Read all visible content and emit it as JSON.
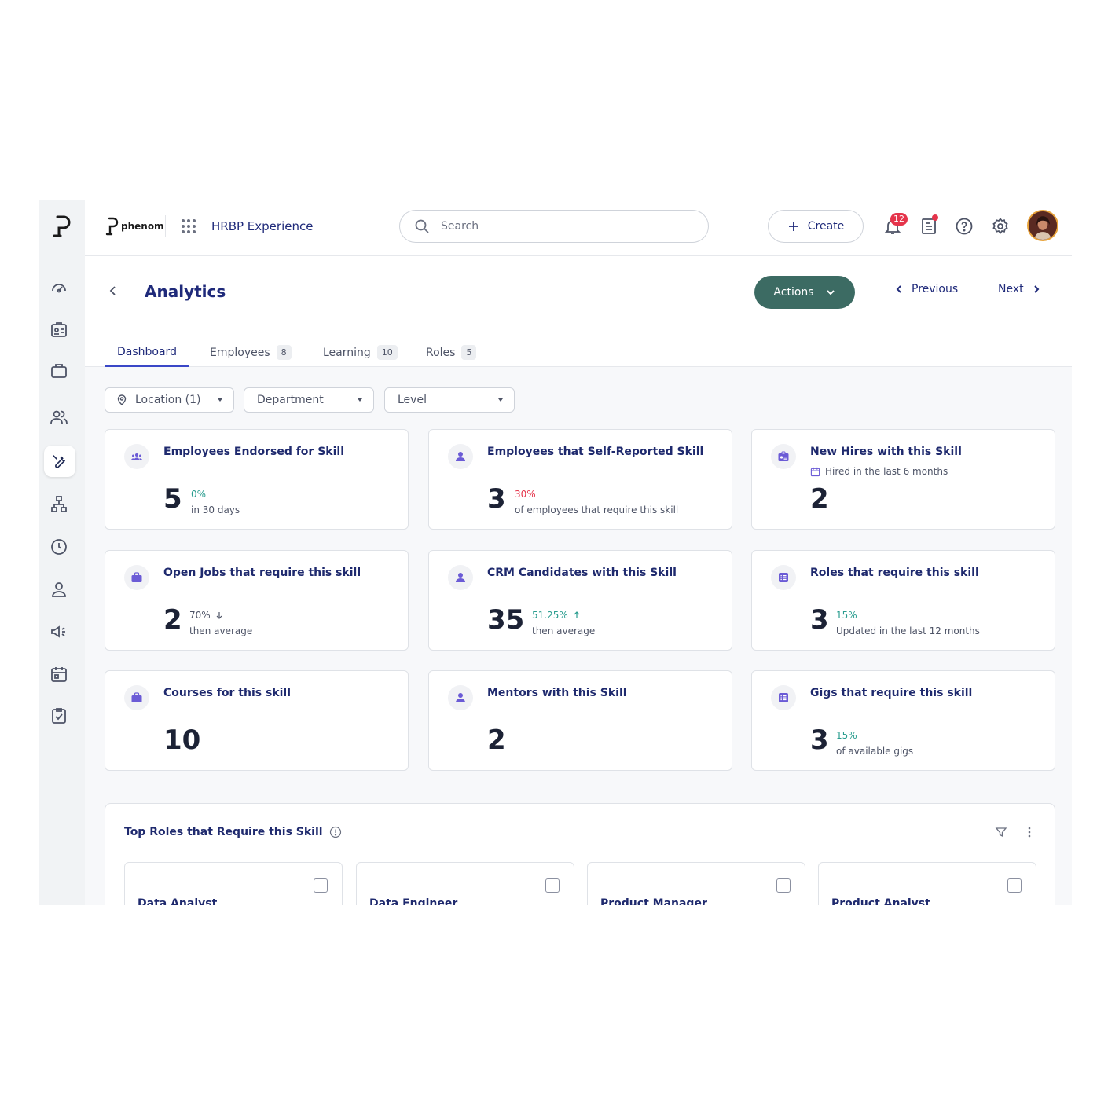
{
  "topbar": {
    "brand_name": "phenom",
    "app_title": "HRBP Experience",
    "search_placeholder": "Search",
    "create_label": "Create",
    "notifications_count": "12"
  },
  "rail": {
    "items": [
      "dashboard",
      "contacts",
      "briefcase",
      "people",
      "skills",
      "org-chart",
      "history",
      "person",
      "campaigns",
      "calendar",
      "tasks"
    ]
  },
  "page": {
    "title": "Analytics",
    "actions_label": "Actions",
    "previous_label": "Previous",
    "next_label": "Next"
  },
  "tabs": [
    {
      "label": "Dashboard",
      "count": null,
      "active": true
    },
    {
      "label": "Employees",
      "count": "8"
    },
    {
      "label": "Learning",
      "count": "10"
    },
    {
      "label": "Roles",
      "count": "5"
    }
  ],
  "filters": [
    {
      "label": "Location (1)"
    },
    {
      "label": "Department"
    },
    {
      "label": "Level"
    }
  ],
  "cards": [
    {
      "title": "Employees Endorsed for Skill",
      "value": "5",
      "delta": "0%",
      "note": "in 30 days",
      "icon": "group-icon"
    },
    {
      "title": "Employees that Self-Reported Skill",
      "value": "3",
      "delta": "30%",
      "note": "of employees that require this skill",
      "icon": "person-icon"
    },
    {
      "title": "New Hires with this Skill",
      "subtitle": "Hired in the last 6 months",
      "value": "2",
      "icon": "badge-icon"
    },
    {
      "title": "Open Jobs that require this skill",
      "value": "2",
      "delta": "70%",
      "note": "then average",
      "icon": "briefcase-icon"
    },
    {
      "title": "CRM Candidates with this Skill",
      "value": "35",
      "delta": "51.25%",
      "note": "then average",
      "icon": "person-icon"
    },
    {
      "title": "Roles that require this skill",
      "value": "3",
      "delta": "15%",
      "note": "Updated in the last 12 months",
      "icon": "list-icon"
    },
    {
      "title": "Courses for this skill",
      "value": "10",
      "icon": "briefcase-icon"
    },
    {
      "title": "Mentors with this Skill",
      "value": "2",
      "icon": "person-icon"
    },
    {
      "title": "Gigs that require this skill",
      "value": "3",
      "delta": "15%",
      "note": "of available gigs",
      "icon": "list-icon"
    }
  ],
  "top_roles": {
    "title": "Top Roles that Require this Skill",
    "roles": [
      "Data Analyst",
      "Data Engineer",
      "Product Manager",
      "Product Analyst"
    ]
  },
  "colors": {
    "accent": "#3c6b63",
    "link": "#1f2a7a",
    "positive": "#2a9d8f",
    "negative": "#e5344b",
    "icon_purple": "#6b5bd6"
  }
}
